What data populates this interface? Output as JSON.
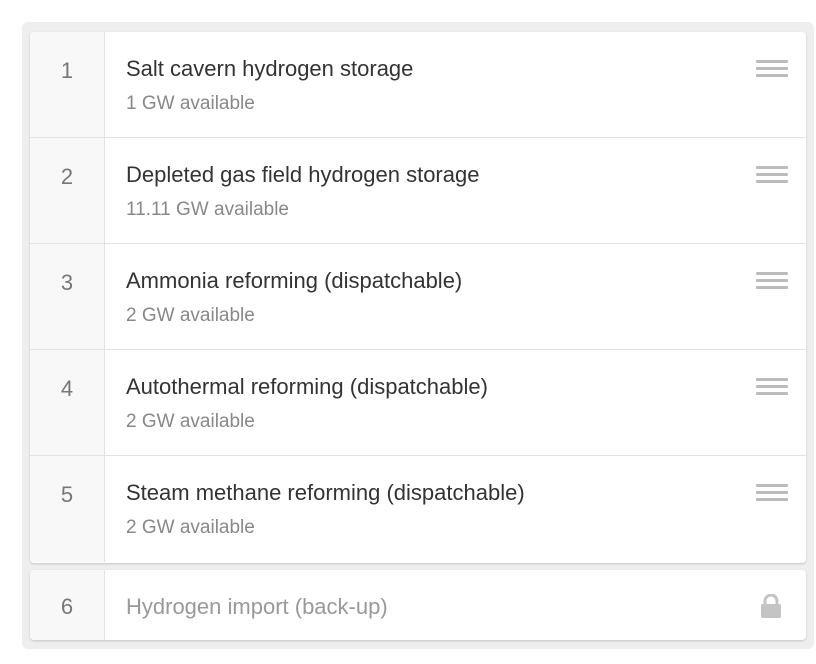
{
  "merit_order": {
    "items": [
      {
        "position": "1",
        "name": "Salt cavern hydrogen storage",
        "capacity": "1 GW available"
      },
      {
        "position": "2",
        "name": "Depleted gas field hydrogen storage",
        "capacity": "11.11 GW available"
      },
      {
        "position": "3",
        "name": "Ammonia reforming (dispatchable)",
        "capacity": "2 GW available"
      },
      {
        "position": "4",
        "name": "Autothermal reforming (dispatchable)",
        "capacity": "2 GW available"
      },
      {
        "position": "5",
        "name": "Steam methane reforming (dispatchable)",
        "capacity": "2 GW available"
      }
    ],
    "fixed_item": {
      "position": "6",
      "name": "Hydrogen import (back-up)"
    }
  },
  "icons": {
    "drag": "drag-handle-icon",
    "lock": "lock-icon"
  },
  "colors": {
    "panel_bg": "#eeeeee",
    "number_column_bg": "#f8f8f8",
    "title_text": "#333333",
    "muted_text": "#888888",
    "icon": "#bbbbbb"
  }
}
